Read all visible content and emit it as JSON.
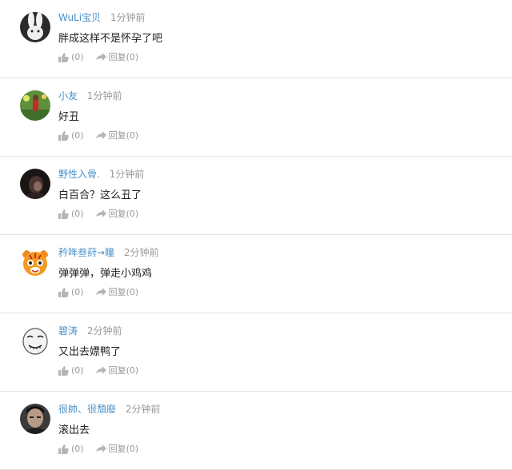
{
  "comments": [
    {
      "user": "WuLi宝贝",
      "time": "1分钟前",
      "text": "胖成这样不是怀孕了吧",
      "like_count": "(0)",
      "reply_label": "回复(0)",
      "avatar_icon": "rabbit-avatar-icon"
    },
    {
      "user": "小友",
      "time": "1分钟前",
      "text": "好丑",
      "like_count": "(0)",
      "reply_label": "回复(0)",
      "avatar_icon": "flower-garden-avatar-icon"
    },
    {
      "user": "野性入骨.",
      "time": "1分钟前",
      "text": "白百合？这么丑了",
      "like_count": "(0)",
      "reply_label": "回复(0)",
      "avatar_icon": "dark-portrait-avatar-icon"
    },
    {
      "user": "矜哖叁葤→瞳",
      "time": "2分钟前",
      "text": "弹弹弹，弹走小鸡鸡",
      "like_count": "(0)",
      "reply_label": "回复(0)",
      "avatar_icon": "tiger-cartoon-avatar-icon"
    },
    {
      "user": "碧涛",
      "time": "2分钟前",
      "text": "又出去嫖鸭了",
      "like_count": "(0)",
      "reply_label": "回复(0)",
      "avatar_icon": "meme-face-avatar-icon"
    },
    {
      "user": "很帥、很頹廢",
      "time": "2分钟前",
      "text": "滚出去",
      "like_count": "(0)",
      "reply_label": "回复(0)",
      "avatar_icon": "man-photo-avatar-icon"
    }
  ],
  "colors": {
    "username": "#4a90c8",
    "meta": "#999999",
    "divider": "#e3e3e3"
  }
}
